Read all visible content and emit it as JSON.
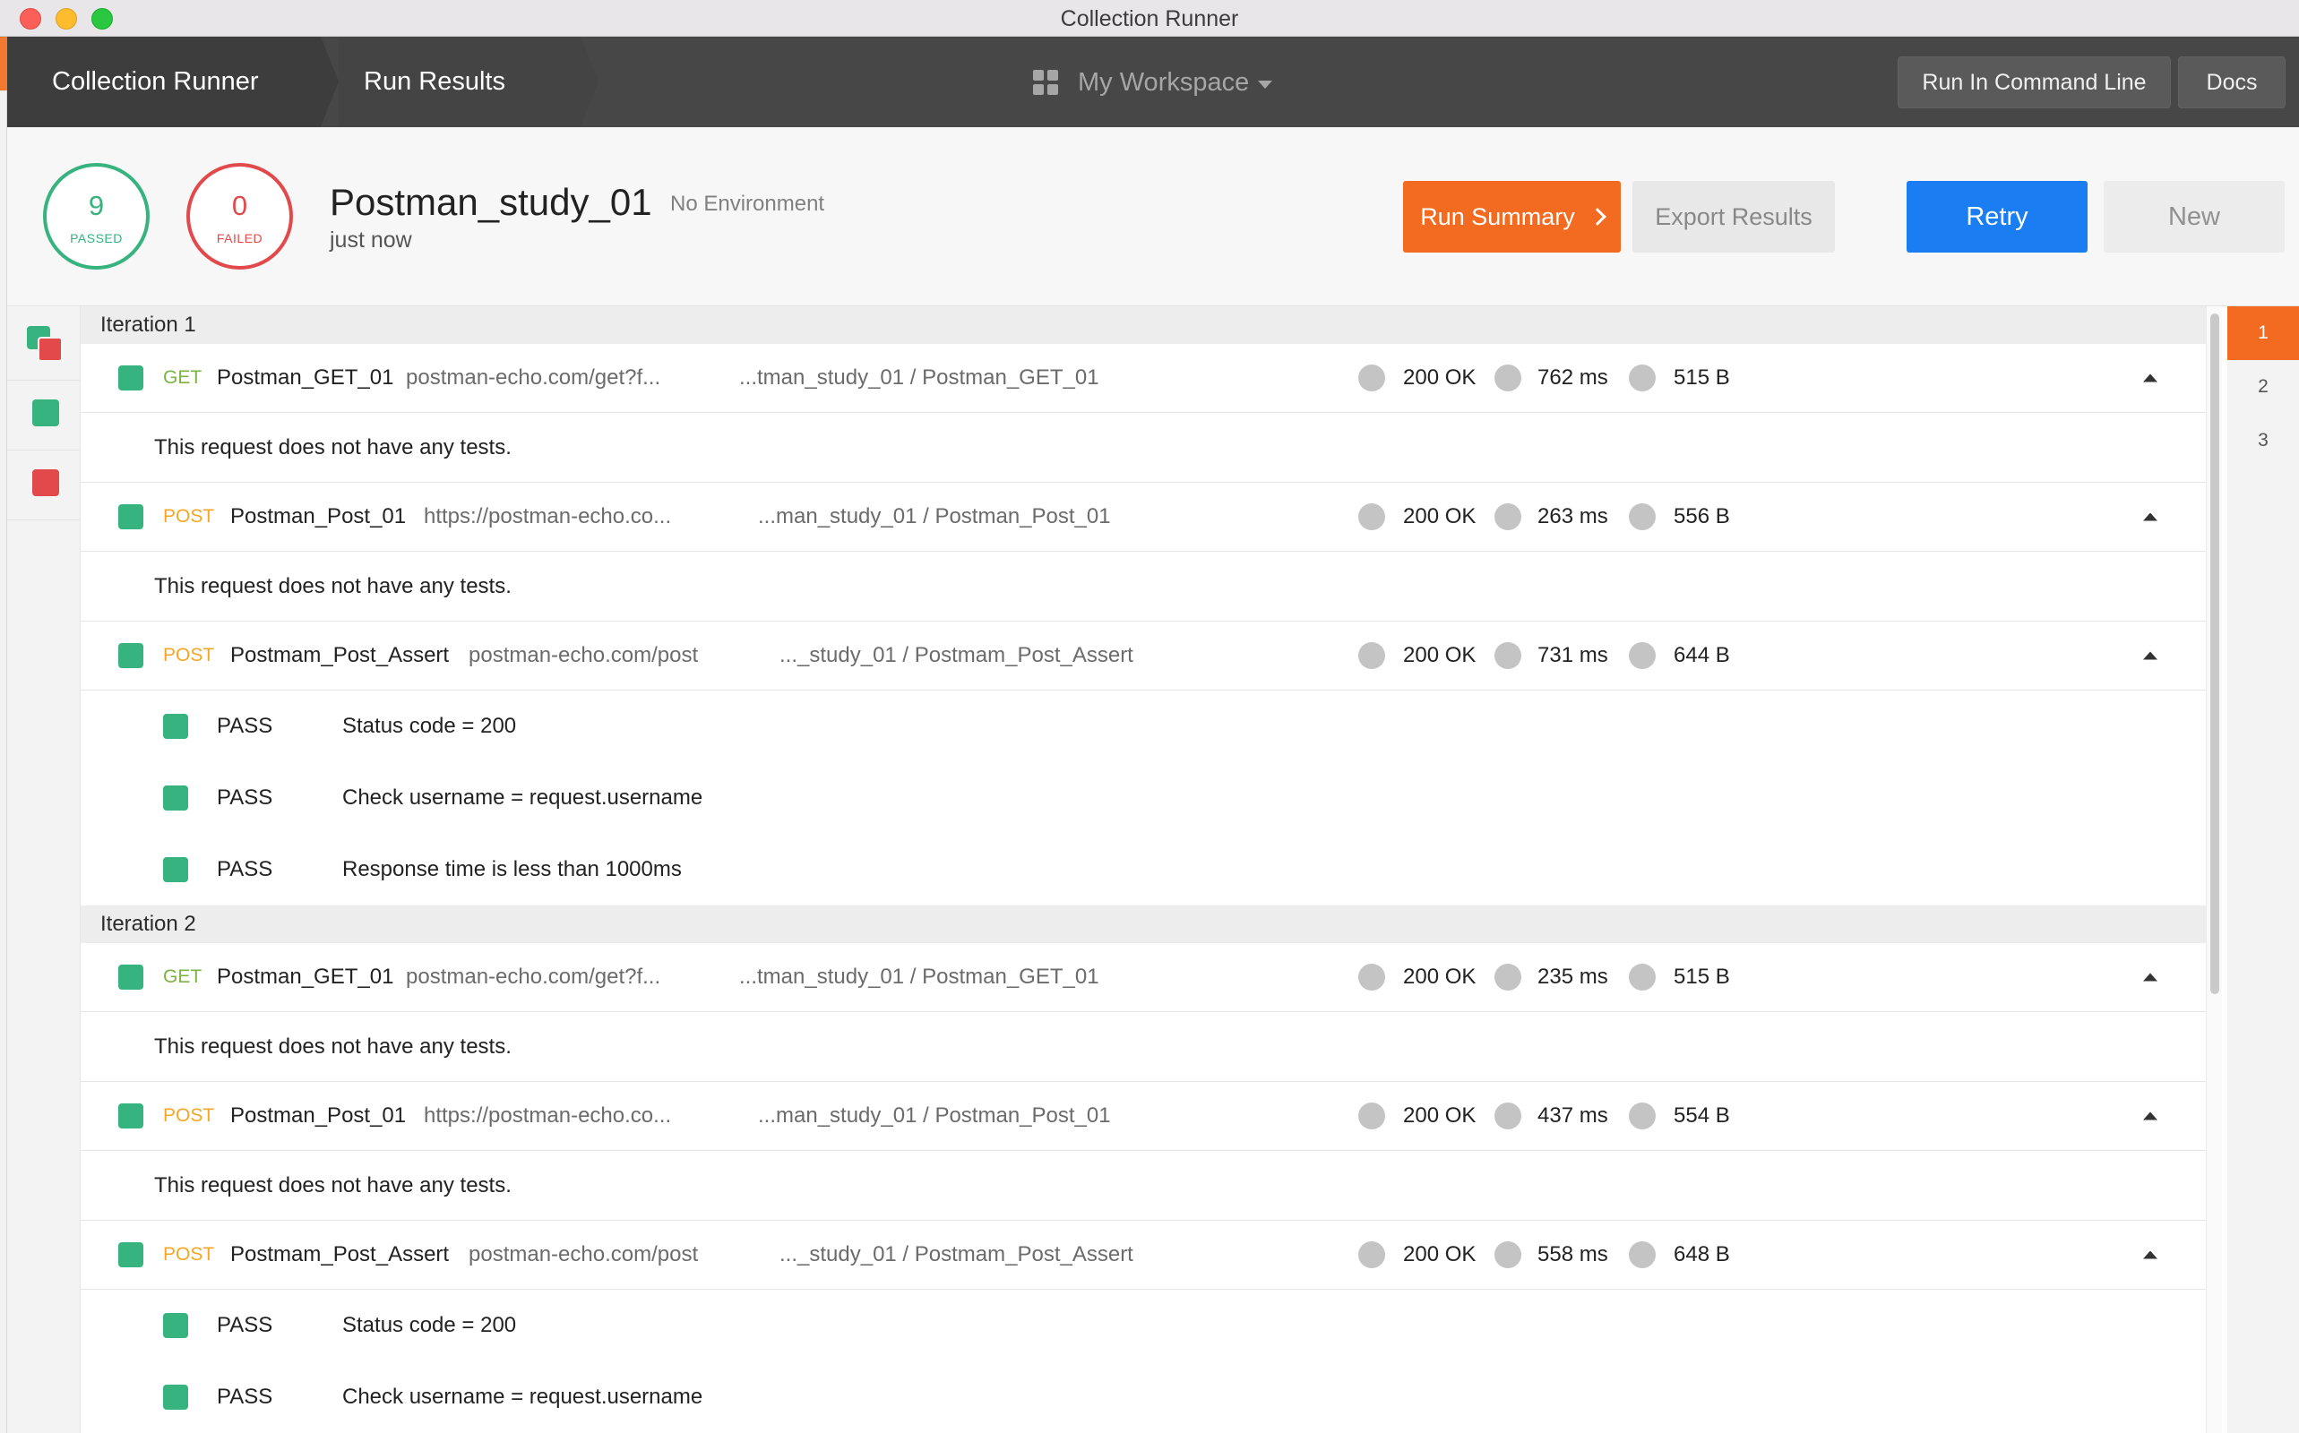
{
  "window": {
    "title": "Collection Runner"
  },
  "header": {
    "crumbs": [
      "Collection Runner",
      "Run Results"
    ],
    "workspace": "My Workspace",
    "run_cli_label": "Run In Command Line",
    "docs_label": "Docs"
  },
  "summary": {
    "passed_count": "9",
    "passed_label": "PASSED",
    "failed_count": "0",
    "failed_label": "FAILED",
    "run_name": "Postman_study_01",
    "environment": "No Environment",
    "time_ago": "just now",
    "run_summary_label": "Run Summary",
    "export_label": "Export Results",
    "retry_label": "Retry",
    "new_label": "New"
  },
  "iteration_nav": [
    "1",
    "2",
    "3"
  ],
  "iterations": [
    {
      "label": "Iteration 1",
      "requests": [
        {
          "method": "GET",
          "name": "Postman_GET_01",
          "url": "postman-echo.com/get?f...",
          "path": "...tman_study_01 / Postman_GET_01",
          "status": "200 OK",
          "time": "762 ms",
          "size": "515 B",
          "note": "This request does not have any tests."
        },
        {
          "method": "POST",
          "name": "Postman_Post_01",
          "url": "https://postman-echo.co...",
          "path": "...man_study_01 / Postman_Post_01",
          "status": "200 OK",
          "time": "263 ms",
          "size": "556 B",
          "note": "This request does not have any tests."
        },
        {
          "method": "POST",
          "name": "Postmam_Post_Assert",
          "url": "postman-echo.com/post",
          "path": "..._study_01 / Postmam_Post_Assert",
          "status": "200 OK",
          "time": "731 ms",
          "size": "644 B",
          "tests": [
            {
              "status": "PASS",
              "name": "Status code = 200"
            },
            {
              "status": "PASS",
              "name": "Check username = request.username"
            },
            {
              "status": "PASS",
              "name": "Response time is less than 1000ms"
            }
          ]
        }
      ]
    },
    {
      "label": "Iteration 2",
      "requests": [
        {
          "method": "GET",
          "name": "Postman_GET_01",
          "url": "postman-echo.com/get?f...",
          "path": "...tman_study_01 / Postman_GET_01",
          "status": "200 OK",
          "time": "235 ms",
          "size": "515 B",
          "note": "This request does not have any tests."
        },
        {
          "method": "POST",
          "name": "Postman_Post_01",
          "url": "https://postman-echo.co...",
          "path": "...man_study_01 / Postman_Post_01",
          "status": "200 OK",
          "time": "437 ms",
          "size": "554 B",
          "note": "This request does not have any tests."
        },
        {
          "method": "POST",
          "name": "Postmam_Post_Assert",
          "url": "postman-echo.com/post",
          "path": "..._study_01 / Postmam_Post_Assert",
          "status": "200 OK",
          "time": "558 ms",
          "size": "648 B",
          "tests": [
            {
              "status": "PASS",
              "name": "Status code = 200"
            },
            {
              "status": "PASS",
              "name": "Check username = request.username"
            }
          ]
        }
      ]
    }
  ],
  "colors": {
    "pass": "#36b37e",
    "fail": "#e2494b",
    "accent_orange": "#f26b21",
    "accent_blue": "#1a7ef2",
    "get_method": "#7cb342",
    "post_method": "#f5a623"
  },
  "icons": {
    "workspace": "grid-icon",
    "dropdown": "caret-down-icon",
    "summary_arrow": "chevron-right-icon",
    "collapse": "caret-up-icon",
    "status": "circle-icon"
  }
}
